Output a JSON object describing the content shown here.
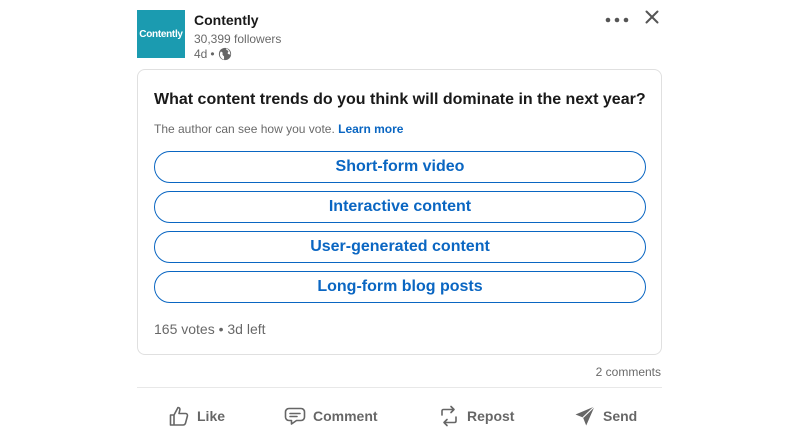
{
  "post": {
    "author": {
      "name": "Contently",
      "logo_text": "Contently",
      "followers": "30,399 followers",
      "age": "4d",
      "separator": "•"
    },
    "poll": {
      "question": "What content trends do you think will dominate in the next year?",
      "note": "The author can see how you vote.",
      "learn_more": "Learn more",
      "options": [
        "Short-form video",
        "Interactive content",
        "User-generated content",
        "Long-form blog posts"
      ],
      "summary": "165 votes • 3d left"
    },
    "comments_count": "2 comments",
    "actions": {
      "like": "Like",
      "comment": "Comment",
      "repost": "Repost",
      "send": "Send"
    }
  },
  "colors": {
    "brand": "#1b9bb0",
    "link": "#0a66c2",
    "text_muted": "#666666"
  },
  "icons": [
    "more-icon",
    "close-icon",
    "globe-icon",
    "like-icon",
    "comment-icon",
    "repost-icon",
    "send-icon"
  ]
}
